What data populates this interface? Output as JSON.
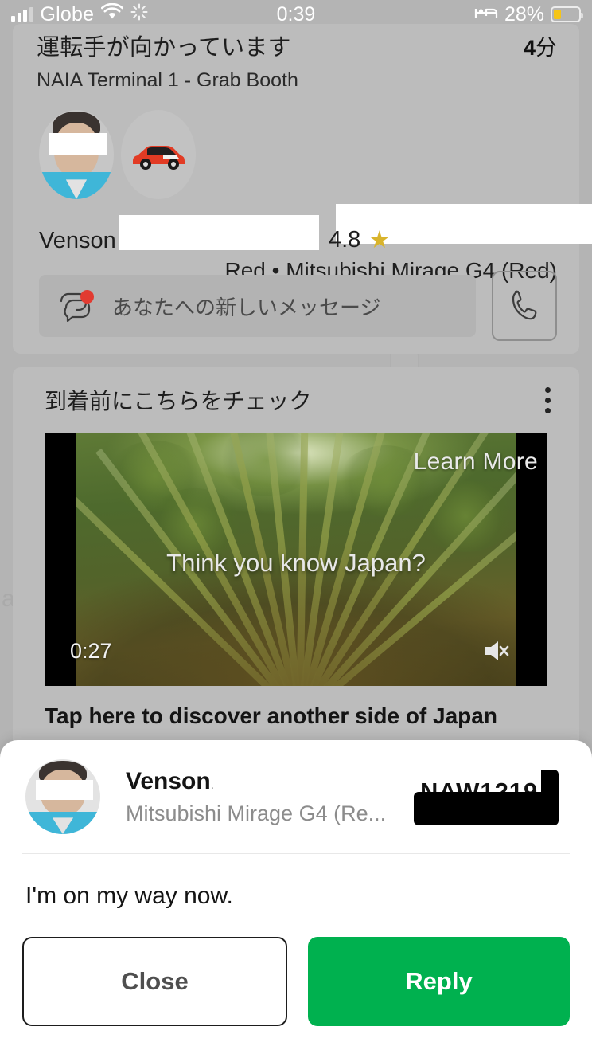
{
  "status_bar": {
    "carrier": "Globe",
    "signal_bars_filled": 3,
    "signal_bars_total": 4,
    "wifi_icon": "wifi-icon",
    "activity_icon": "activity-spinner-icon",
    "time": "0:39",
    "sleep_icon": "bed-icon",
    "battery_percent": "28%",
    "battery_level": 28,
    "battery_color": "#f5c518"
  },
  "trip": {
    "title": "運転手が向かっています",
    "eta_value": "4",
    "eta_unit": "分",
    "pickup": "NAIA Terminal 1 - Grab Booth"
  },
  "driver": {
    "avatar_icon": "driver-avatar",
    "car_icon": "red-car-icon",
    "plate_redaction": "",
    "vehicle": "Red • Mitsubishi Mirage G4 (Red)",
    "name": "Venson",
    "name_redaction": "",
    "rating": "4.8",
    "star_icon": "star-icon",
    "star_color": "#d9b42c"
  },
  "message_bar": {
    "chat_icon": "chat-bubble-icon",
    "badge_color": "#e23b31",
    "text": "あなたへの新しいメッセージ",
    "call_icon": "phone-icon"
  },
  "ad": {
    "title": "到着前にこちらをチェック",
    "menu_icon": "kebab-menu-icon",
    "learn_more": "Learn More",
    "video_caption": "Think you know Japan?",
    "video_time": "0:27",
    "mute_icon": "speaker-mute-icon",
    "footer": "Tap here to discover another side of Japan"
  },
  "sheet": {
    "avatar_icon": "driver-avatar",
    "name": "Venson",
    "name_suffix": ".",
    "vehicle": "Mitsubishi Mirage G4 (Re...",
    "plate": "NAW1219",
    "message": "I'm on my way now.",
    "close_label": "Close",
    "reply_label": "Reply",
    "reply_color": "#00b14f"
  },
  "background": {
    "map_glyph": "a"
  }
}
